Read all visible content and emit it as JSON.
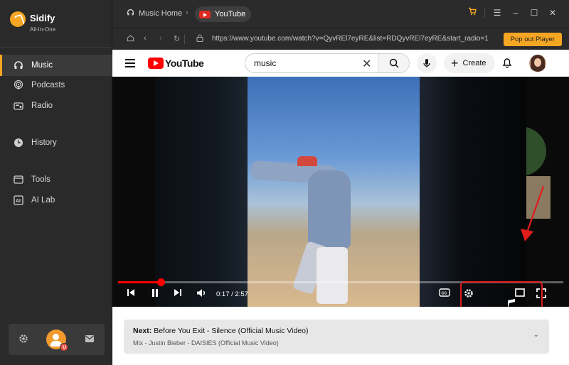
{
  "app": {
    "name": "Sidify",
    "subtitle": "All-In-One"
  },
  "sidebar": {
    "items": [
      {
        "label": "Music",
        "icon": "headphones-icon",
        "active": true
      },
      {
        "label": "Podcasts",
        "icon": "podcast-icon",
        "active": false
      },
      {
        "label": "Radio",
        "icon": "radio-icon",
        "active": false
      },
      {
        "label": "History",
        "icon": "clock-icon",
        "active": false
      },
      {
        "label": "Tools",
        "icon": "tools-icon",
        "active": false
      },
      {
        "label": "AI Lab",
        "icon": "ai-icon",
        "active": false
      }
    ],
    "bottom_icons": [
      "settings-icon",
      "user-avatar",
      "mail-icon"
    ],
    "user_badge": "U"
  },
  "topbar": {
    "home_tab": "Music Home",
    "active_tab": "YouTube"
  },
  "addressbar": {
    "url": "https://www.youtube.com/watch?v=QyvREl7eyRE&list=RDQyvREl7eyRE&start_radio=1",
    "popout_label": "Pop out Player"
  },
  "youtube": {
    "logo_text": "YouTube",
    "search_value": "music",
    "create_label": "Create"
  },
  "player": {
    "time": "0:17 / 2:57",
    "progress": 0.096
  },
  "next": {
    "prefix": "Next:",
    "title": "Before You Exit - Silence (Official Music Video)",
    "subtitle": "Mix - Justin Bieber - DAISIES (Official Music Video)"
  },
  "colors": {
    "accent": "#f5a623",
    "youtube_red": "#ff0000",
    "highlight": "#e21b1b"
  }
}
